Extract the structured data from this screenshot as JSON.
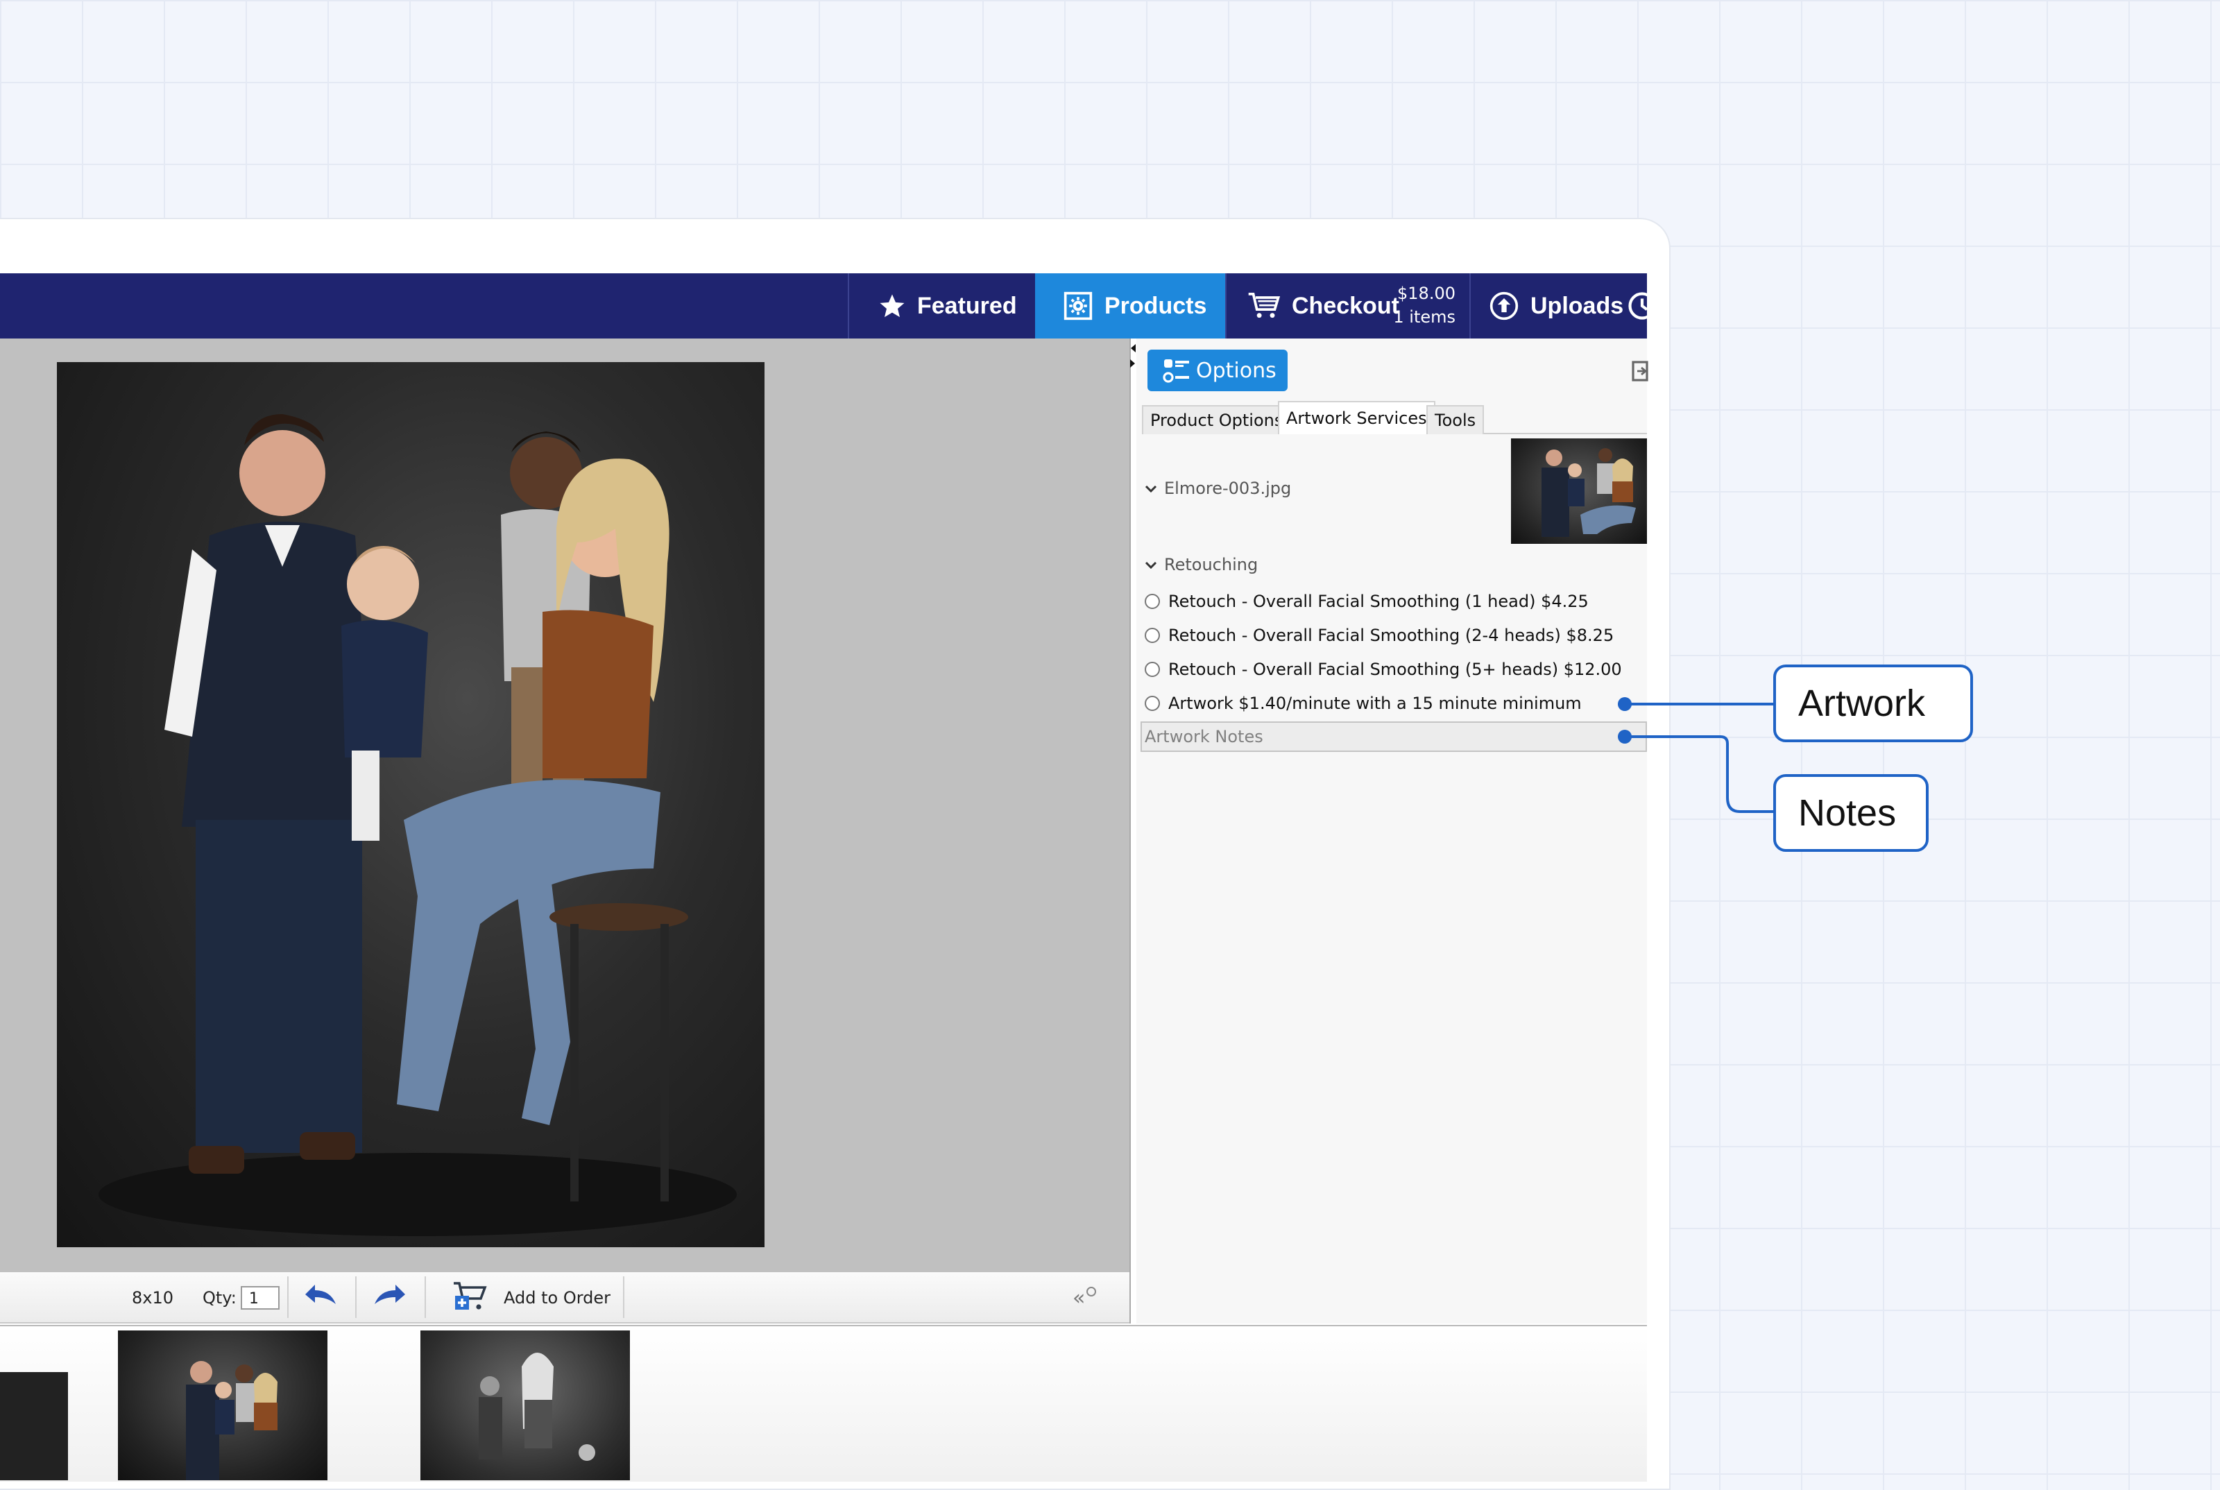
{
  "nav": {
    "featured": "Featured",
    "products": "Products",
    "checkout": "Checkout",
    "checkout_total": "$18.00",
    "checkout_items": "1 items",
    "uploads": "Uploads"
  },
  "toolbar": {
    "size": "8x10",
    "qty_label": "Qty:",
    "qty_value": "1",
    "add_to_order": "Add to Order"
  },
  "panel": {
    "options_button": "Options",
    "tabs": [
      "Product Options",
      "Artwork Services",
      "Tools"
    ],
    "active_tab": "Artwork Services",
    "file_name": "Elmore-003.jpg",
    "section": "Retouching",
    "options": [
      "Retouch - Overall Facial Smoothing (1 head) $4.25",
      "Retouch - Overall Facial Smoothing (2-4 heads) $8.25",
      "Retouch - Overall Facial Smoothing (5+ heads) $12.00",
      "Artwork $1.40/minute with a 15 minute minimum"
    ],
    "notes_placeholder": "Artwork Notes"
  },
  "callouts": {
    "artwork": "Artwork",
    "notes": "Notes"
  },
  "colors": {
    "nav_bg": "#1f2470",
    "accent": "#1e88dc",
    "callout": "#1f63c6"
  }
}
